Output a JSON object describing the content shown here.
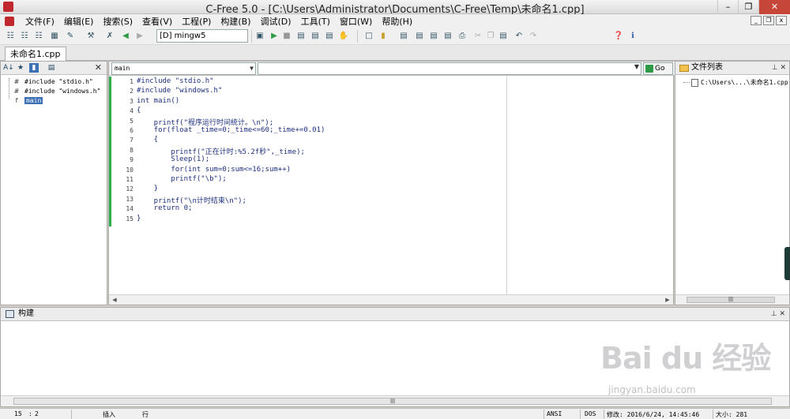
{
  "window": {
    "title": "C-Free 5.0 - [C:\\Users\\Administrator\\Documents\\C-Free\\Temp\\未命名1.cpp]"
  },
  "menu": [
    "文件(F)",
    "编辑(E)",
    "搜索(S)",
    "查看(V)",
    "工程(P)",
    "构建(B)",
    "调试(D)",
    "工具(T)",
    "窗口(W)",
    "帮助(H)"
  ],
  "toolbar": {
    "compiler": "[D] mingw5"
  },
  "tabs": [
    "未命名1.cpp"
  ],
  "class_view": {
    "items": [
      "#include \"stdio.h\"",
      "#include \"windows.h\"",
      "main"
    ],
    "selected": "main"
  },
  "editor": {
    "function_selector": "main",
    "go_button": "Go",
    "lines": [
      "#include \"stdio.h\"",
      "#include \"windows.h\"",
      "int main()",
      "{",
      "    printf(\"程序运行时间统计。\\n\");",
      "    for(float _time=0;_time<=60;_time+=0.01)",
      "    {",
      "        printf(\"正在计时:%5.2f秒\",_time);",
      "        Sleep(1);",
      "        for(int sum=0;sum<=16;sum++)",
      "        printf(\"\\b\");",
      "    }",
      "    printf(\"\\n计时结束\\n\");",
      "    return 0;",
      "}"
    ]
  },
  "file_list": {
    "title": "文件列表",
    "files": [
      "C:\\Users\\...\\未命名1.cpp"
    ]
  },
  "build_panel": {
    "title": "构建"
  },
  "statusbar": {
    "line": "15",
    "col": "2",
    "insert_mode": "插入",
    "row_label": "行",
    "encoding": "ANSI",
    "line_ending": "DOS",
    "modified": "修改: 2016/6/24, 14:45:46",
    "size": "大小: 281"
  },
  "watermark": {
    "brand": "Bai du 经验",
    "url": "jingyan.baidu.com"
  },
  "colors": {
    "code_text": "#1d2f7d",
    "selection": "#3b6fb6",
    "modified_bar": "#2fae4c",
    "close_button": "#c7463a"
  }
}
